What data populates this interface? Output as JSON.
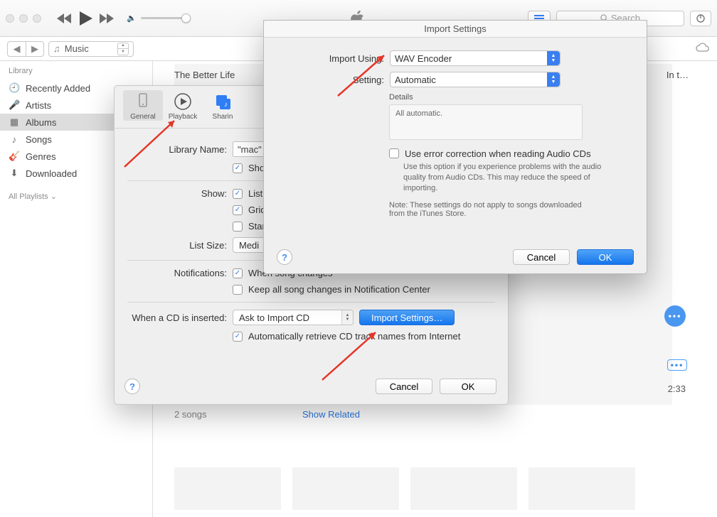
{
  "toolbar": {
    "search_placeholder": "Search"
  },
  "navbar": {
    "source": "Music"
  },
  "sidebar": {
    "header": "Library",
    "items": [
      {
        "label": "Recently Added"
      },
      {
        "label": "Artists"
      },
      {
        "label": "Albums"
      },
      {
        "label": "Songs"
      },
      {
        "label": "Genres"
      },
      {
        "label": "Downloaded"
      }
    ],
    "playlists_header": "All Playlists"
  },
  "main": {
    "album_title": "The Better Life",
    "right_text": "In t…",
    "duration": "2:33",
    "songs_count": "2 songs",
    "show_related": "Show Related"
  },
  "prefs": {
    "tabs": {
      "general": "General",
      "playback": "Playback",
      "sharing": "Sharin"
    },
    "library_name_label": "Library Name:",
    "library_name_value": "\"mac\"",
    "show_checkbox_label": "Sho",
    "show_label": "Show:",
    "show_list": "List",
    "show_grid": "Grid",
    "show_star": "Star",
    "list_size_label": "List Size:",
    "list_size_value": "Medi",
    "notifications_label": "Notifications:",
    "notif_song": "When song changes",
    "notif_nc": "Keep all song changes in Notification Center",
    "cd_label": "When a CD is inserted:",
    "cd_value": "Ask to Import CD",
    "import_settings_btn": "Import Settings…",
    "auto_cd": "Automatically retrieve CD track names from Internet",
    "cancel": "Cancel",
    "ok": "OK"
  },
  "sheet": {
    "title": "Import Settings",
    "import_using_label": "Import Using:",
    "import_using_value": "WAV Encoder",
    "setting_label": "Setting:",
    "setting_value": "Automatic",
    "details_label": "Details",
    "details_text": "All automatic.",
    "ec_label": "Use error correction when reading Audio CDs",
    "ec_help": "Use this option if you experience problems with the audio quality from Audio CDs.  This may reduce the speed of importing.",
    "note": "Note: These settings do not apply to songs downloaded from the iTunes Store.",
    "cancel": "Cancel",
    "ok": "OK"
  }
}
